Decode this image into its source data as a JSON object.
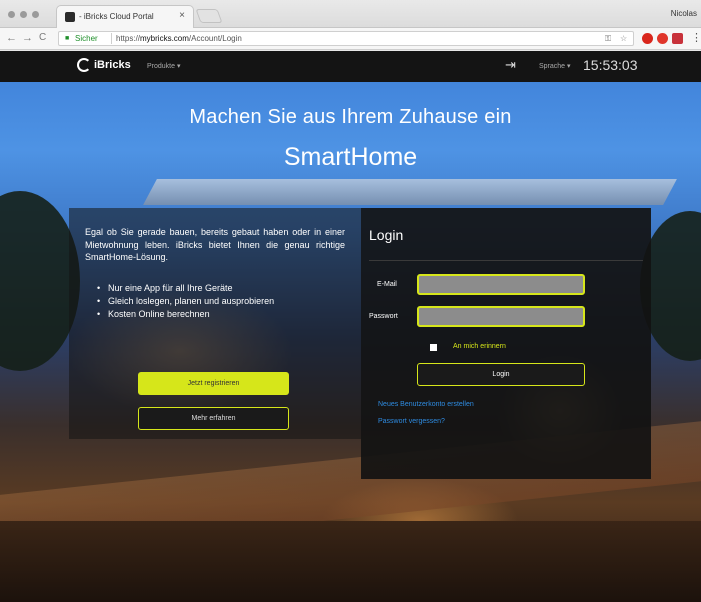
{
  "browser": {
    "tab_title": "- iBricks Cloud Portal",
    "tab_close": "×",
    "profile_name": "Nicolas",
    "secure_label": "Sicher",
    "url_scheme": "https://",
    "url_host": "mybricks.com",
    "url_path": "/Account/Login",
    "nav": {
      "back": "←",
      "forward": "→",
      "reload": "C"
    },
    "omnibox_icons": [
      "key-icon",
      "star-icon"
    ],
    "extension_icons": [
      "opera-icon",
      "adblock-icon",
      "extension-icon"
    ],
    "menu_icon": "⋮"
  },
  "site_nav": {
    "logo_text": "iBricks",
    "produkte_label": "Produkte",
    "sprache_label": "Sprache",
    "clock": "15:53:03"
  },
  "hero": {
    "line1": "Machen Sie aus Ihrem Zuhause ein",
    "line2": "SmartHome"
  },
  "info": {
    "text": "Egal ob Sie gerade bauen, bereits gebaut haben oder in einer Mietwohnung leben. iBricks bietet Ihnen die genau richtige SmartHome-Lösung.",
    "bullets": [
      "Nur eine App für all Ihre Geräte",
      "Gleich loslegen, planen und ausprobieren",
      "Kosten Online berechnen"
    ],
    "register_label": "Jetzt registrieren",
    "more_label": "Mehr erfahren"
  },
  "login": {
    "title": "Login",
    "email_label": "E-Mail",
    "email_value": "",
    "password_label": "Passwort",
    "password_value": "",
    "remember_label": "An mich erinnern",
    "remember_checked": false,
    "button_label": "Login",
    "new_account_link": "Neues Benutzerkonto erstellen",
    "forgot_link": "Passwort vergessen?"
  },
  "colors": {
    "accent": "#d6e61a",
    "link": "#2e8be0",
    "nav_bg": "#141414"
  }
}
